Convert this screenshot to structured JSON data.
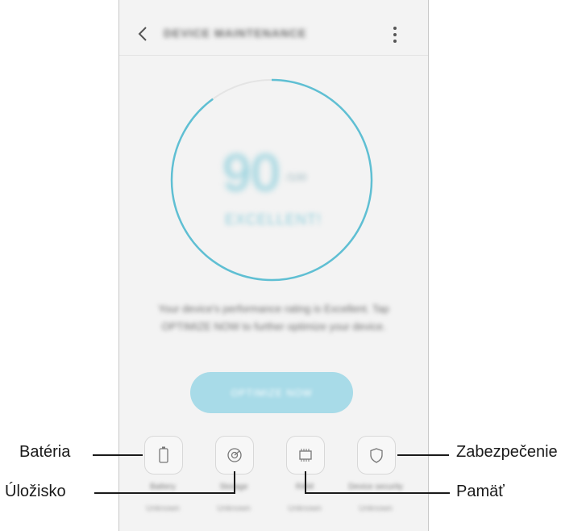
{
  "app": {
    "title": "DEVICE MAINTENANCE",
    "score": "90",
    "score_max": "/100",
    "status": "EXCELLENT!",
    "description": "Your device's performance rating is Excellent. Tap OPTIMIZE NOW to further optimize your device.",
    "optimize_label": "OPTIMIZE NOW",
    "score_fraction": 0.9,
    "accent_color": "#5fbfd3",
    "features": [
      {
        "label": "Battery",
        "sub": "Unknown",
        "icon": "battery-icon"
      },
      {
        "label": "Storage",
        "sub": "Unknown",
        "icon": "storage-icon"
      },
      {
        "label": "RAM",
        "sub": "Unknown",
        "icon": "memory-chip-icon"
      },
      {
        "label": "Device security",
        "sub": "Unknown",
        "icon": "shield-icon"
      }
    ]
  },
  "callouts": {
    "battery": "Batéria",
    "storage": "Úložisko",
    "security": "Zabezpečenie",
    "memory": "Pamäť"
  }
}
